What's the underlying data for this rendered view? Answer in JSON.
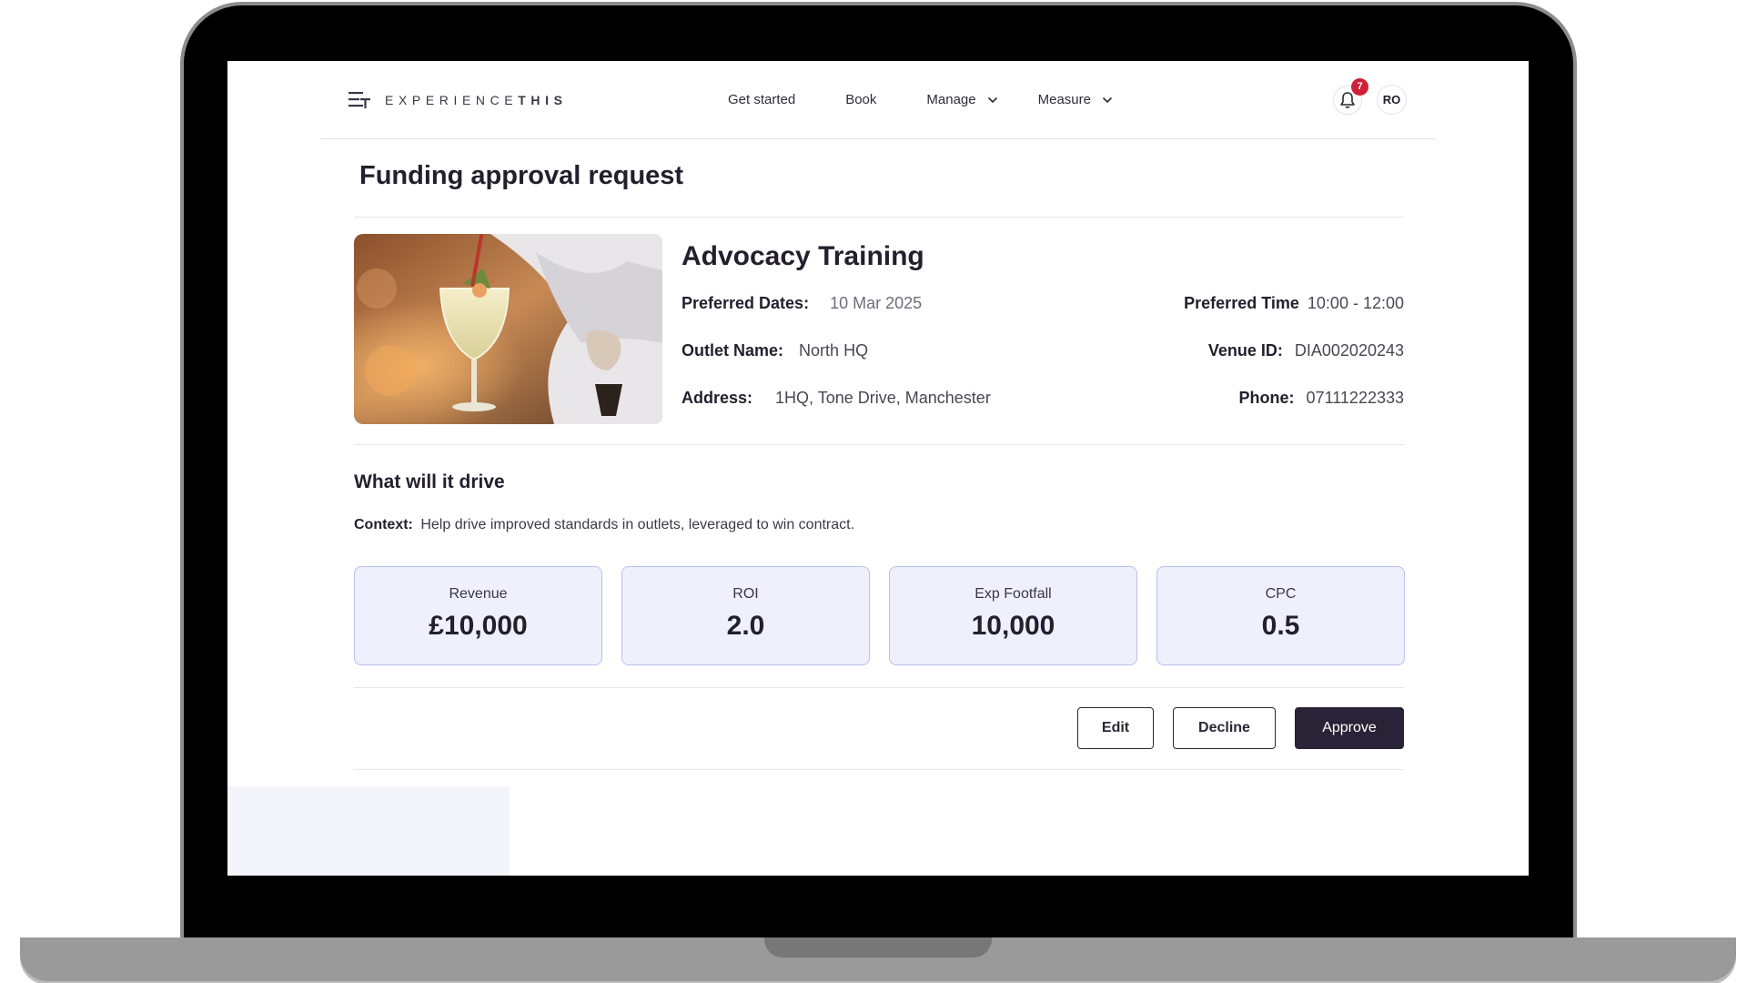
{
  "brand": {
    "logo_light": "EXPERIENCE",
    "logo_bold": "THIS"
  },
  "nav": {
    "links": [
      {
        "label": "Get started",
        "has_dropdown": false
      },
      {
        "label": "Book",
        "has_dropdown": false
      },
      {
        "label": "Manage",
        "has_dropdown": true
      },
      {
        "label": "Measure",
        "has_dropdown": true
      }
    ],
    "notifications_count": "7",
    "avatar_initials": "RO"
  },
  "page": {
    "title": "Funding approval request"
  },
  "event": {
    "title": "Advocacy Training",
    "preferred_dates_label": "Preferred Dates:",
    "preferred_dates_value": "10 Mar 2025",
    "preferred_time_label": "Preferred Time",
    "preferred_time_value": "10:00 - 12:00",
    "outlet_name_label": "Outlet Name:",
    "outlet_name_value": "North HQ",
    "venue_id_label": "Venue ID:",
    "venue_id_value": "DIA002020243",
    "address_label": "Address:",
    "address_value": "1HQ, Tone Drive, Manchester",
    "phone_label": "Phone:",
    "phone_value": "07111222333"
  },
  "drive": {
    "title": "What will it drive",
    "context_label": "Context:",
    "context_value": "Help drive improved standards in outlets, leveraged to win contract."
  },
  "metrics": [
    {
      "label": "Revenue",
      "value": "£10,000"
    },
    {
      "label": "ROI",
      "value": "2.0"
    },
    {
      "label": "Exp Footfall",
      "value": "10,000"
    },
    {
      "label": "CPC",
      "value": "0.5"
    }
  ],
  "actions": {
    "edit": "Edit",
    "decline": "Decline",
    "approve": "Approve"
  },
  "colors": {
    "primary_button": "#2a2236",
    "metric_bg": "#eef0fc",
    "metric_border": "#b9c1ee",
    "badge": "#d01f36"
  },
  "icons": {
    "logo": "logo-bars-icon",
    "bell": "bell-icon",
    "dropdown": "chevron-down-icon"
  }
}
